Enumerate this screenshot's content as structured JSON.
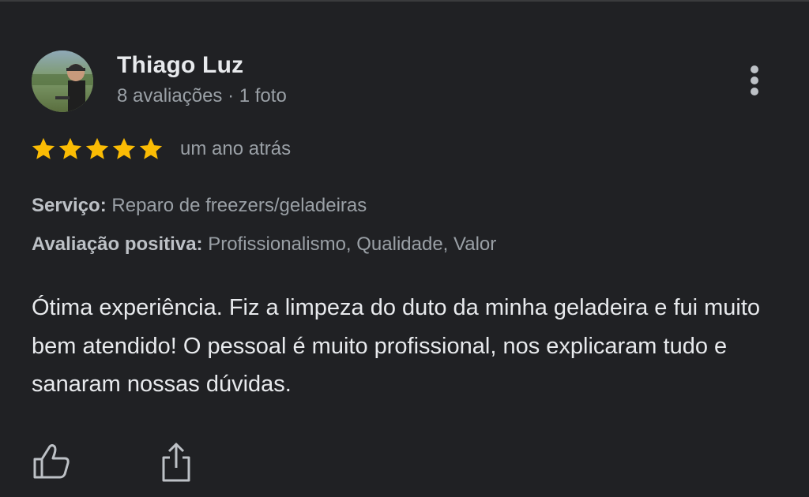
{
  "review": {
    "author": {
      "name": "Thiago Luz",
      "meta": "8 avaliações · 1 foto"
    },
    "rating": 5,
    "rating_max": 5,
    "time": "um ano atrás",
    "details": [
      {
        "label": "Serviço:",
        "value": "Reparo de freezers/geladeiras"
      },
      {
        "label": "Avaliação positiva:",
        "value": "Profissionalismo, Qualidade, Valor"
      }
    ],
    "text": "Ótima experiência. Fiz a limpeza do duto da minha geladeira e fui muito bem atendido! O pessoal é muito profissional, nos explicaram tudo e sanaram nossas dúvidas."
  },
  "icons": {
    "more": "more-vert-icon",
    "like": "thumb-up-icon",
    "share": "share-icon",
    "star": "star-icon"
  },
  "colors": {
    "background": "#202124",
    "star": "#fbbc04",
    "primary_text": "#e8eaed",
    "secondary_text": "#9aa0a6"
  }
}
